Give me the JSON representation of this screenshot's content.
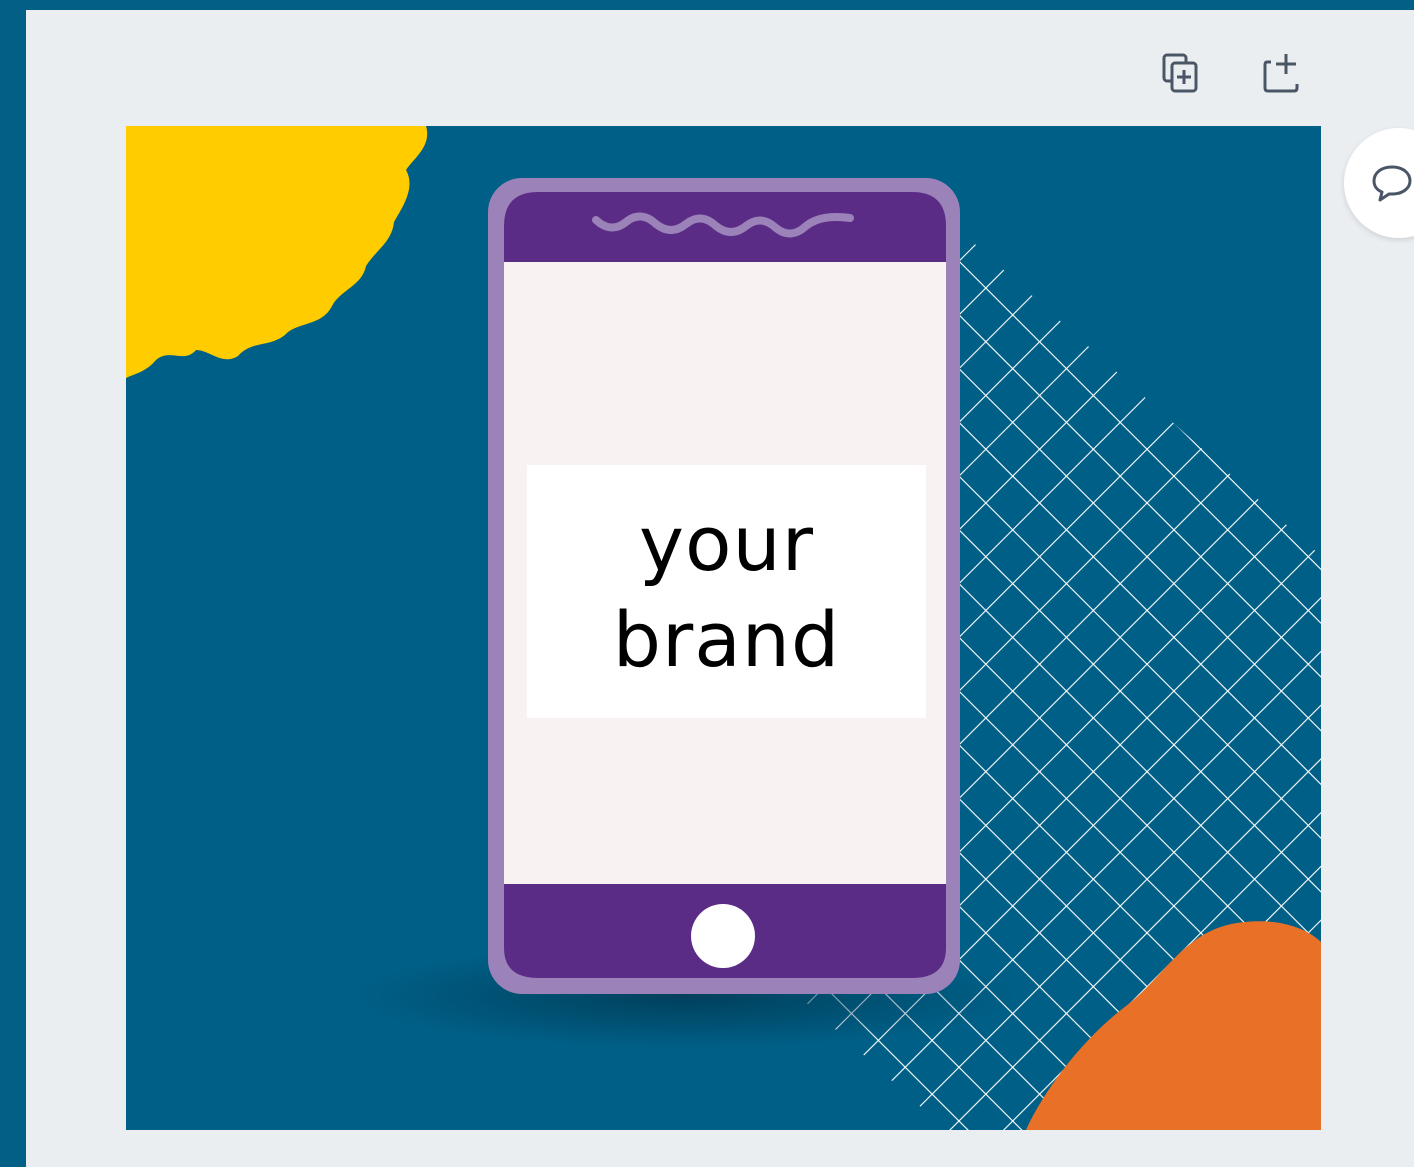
{
  "toolbar": {
    "duplicate_icon": "duplicate-page-icon",
    "add_page_icon": "add-page-icon",
    "comment_icon": "comment-icon"
  },
  "design": {
    "brand_line_1": "your",
    "brand_line_2": "brand"
  },
  "colors": {
    "frame": "#025f86",
    "workspace": "#ebeef1",
    "canvas_bg": "#005f86",
    "sun": "#ffcc00",
    "phone_body": "#9b82b8",
    "phone_bars": "#5b2c86",
    "phone_screen": "#f8f2f2",
    "blob": "#e97127"
  }
}
